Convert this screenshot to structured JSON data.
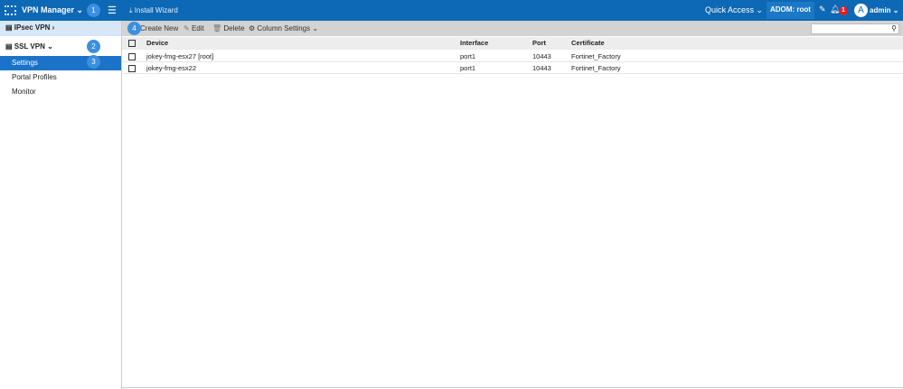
{
  "topbar": {
    "app_name": "VPN Manager",
    "install_wizard": "Install Wizard",
    "quick_access": "Quick Access",
    "adom": "ADOM: root",
    "notification_count": "1",
    "avatar_letter": "A",
    "user": "admin"
  },
  "sidebar": {
    "items": [
      {
        "label": "IPsec VPN"
      },
      {
        "label": "SSL VPN"
      },
      {
        "label": "Settings"
      },
      {
        "label": "Portal Profiles"
      },
      {
        "label": "Monitor"
      }
    ]
  },
  "toolbar": {
    "create_new": "Create New",
    "edit": "Edit",
    "delete": "Delete",
    "column_settings": "Column Settings",
    "search_placeholder": ""
  },
  "table": {
    "columns": [
      "Device",
      "Interface",
      "Port",
      "Certificate"
    ],
    "rows": [
      [
        "jokey-fmg-esx27 [root]",
        "port1",
        "10443",
        "Fortinet_Factory"
      ],
      [
        "jokey-fmg-esx22",
        "port1",
        "10443",
        "Fortinet_Factory"
      ]
    ]
  },
  "callouts": [
    "1",
    "2",
    "3",
    "4"
  ]
}
